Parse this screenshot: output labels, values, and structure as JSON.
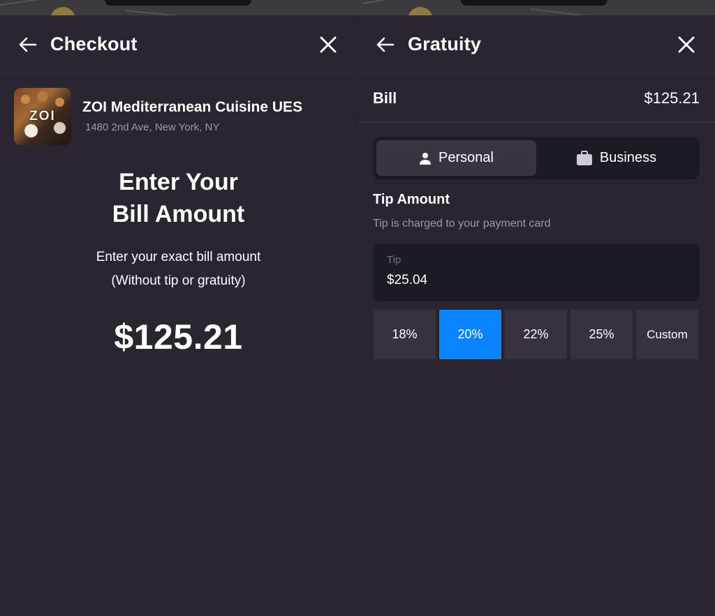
{
  "checkout": {
    "title": "Checkout",
    "restaurant": {
      "logo_text": "ZOI",
      "name": "ZOI Mediterranean Cuisine UES",
      "address": "1480 2nd Ave, New York, NY"
    },
    "heading_line1": "Enter Your",
    "heading_line2": "Bill Amount",
    "subtitle_line1": "Enter your exact bill amount",
    "subtitle_line2": "(Without tip or gratuity)",
    "amount": "$125.21"
  },
  "gratuity": {
    "title": "Gratuity",
    "bill_label": "Bill",
    "bill_value": "$125.21",
    "segments": {
      "personal": "Personal",
      "business": "Business",
      "selected": "Personal"
    },
    "tip_heading": "Tip Amount",
    "tip_note": "Tip is charged to your payment card",
    "tip_field_label": "Tip",
    "tip_field_value": "$25.04",
    "percent_options": [
      "18%",
      "20%",
      "22%",
      "25%",
      "Custom"
    ],
    "selected_option": "20%"
  },
  "colors": {
    "background": "#2b2532",
    "accent": "#0a84ff",
    "muted_text": "#9f98a6"
  },
  "icons": [
    "back-arrow-icon",
    "close-icon",
    "person-icon",
    "briefcase-icon"
  ]
}
